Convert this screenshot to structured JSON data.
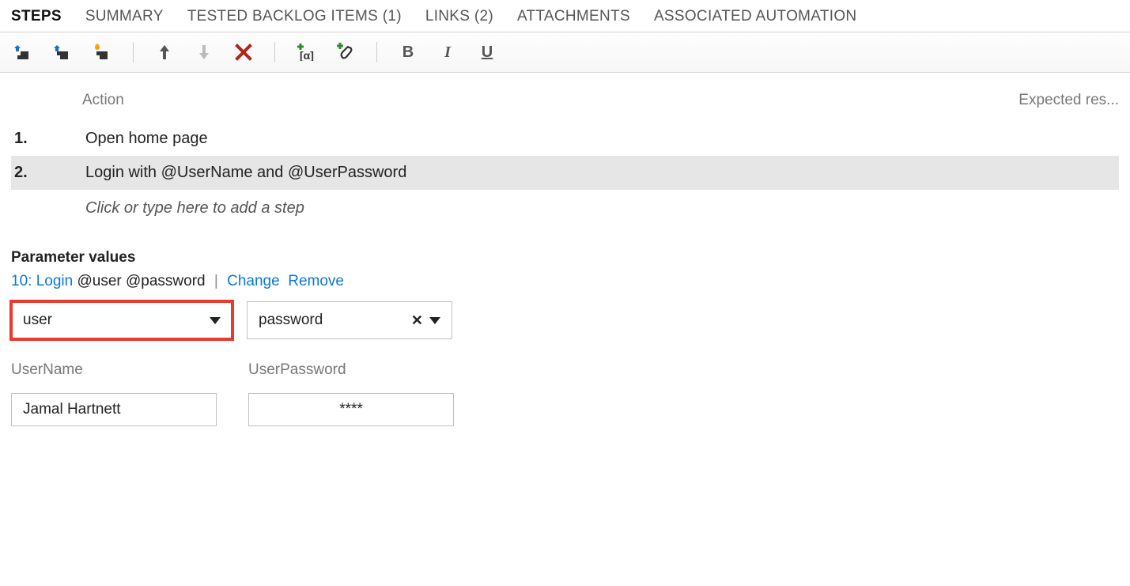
{
  "tabs": [
    {
      "label": "STEPS",
      "active": true
    },
    {
      "label": "SUMMARY",
      "active": false
    },
    {
      "label": "TESTED BACKLOG ITEMS (1)",
      "active": false
    },
    {
      "label": "LINKS (2)",
      "active": false
    },
    {
      "label": "ATTACHMENTS",
      "active": false
    },
    {
      "label": "ASSOCIATED AUTOMATION",
      "active": false
    }
  ],
  "steps_header": {
    "action": "Action",
    "expected": "Expected res..."
  },
  "steps": [
    {
      "num": "1.",
      "action": "Open home page",
      "selected": false
    },
    {
      "num": "2.",
      "action": "Login with  @UserName and  @UserPassword",
      "selected": true
    }
  ],
  "add_step_placeholder": "Click or type here to add a step",
  "params": {
    "title": "Parameter values",
    "set_link_prefix": "10: Login",
    "set_link_suffix": " @user @password",
    "change": "Change",
    "remove": "Remove",
    "dropdown1": "user",
    "dropdown2": "password",
    "cols": [
      {
        "hdr": "UserName",
        "val": "Jamal Hartnett"
      },
      {
        "hdr": "UserPassword",
        "val": "****"
      }
    ]
  }
}
